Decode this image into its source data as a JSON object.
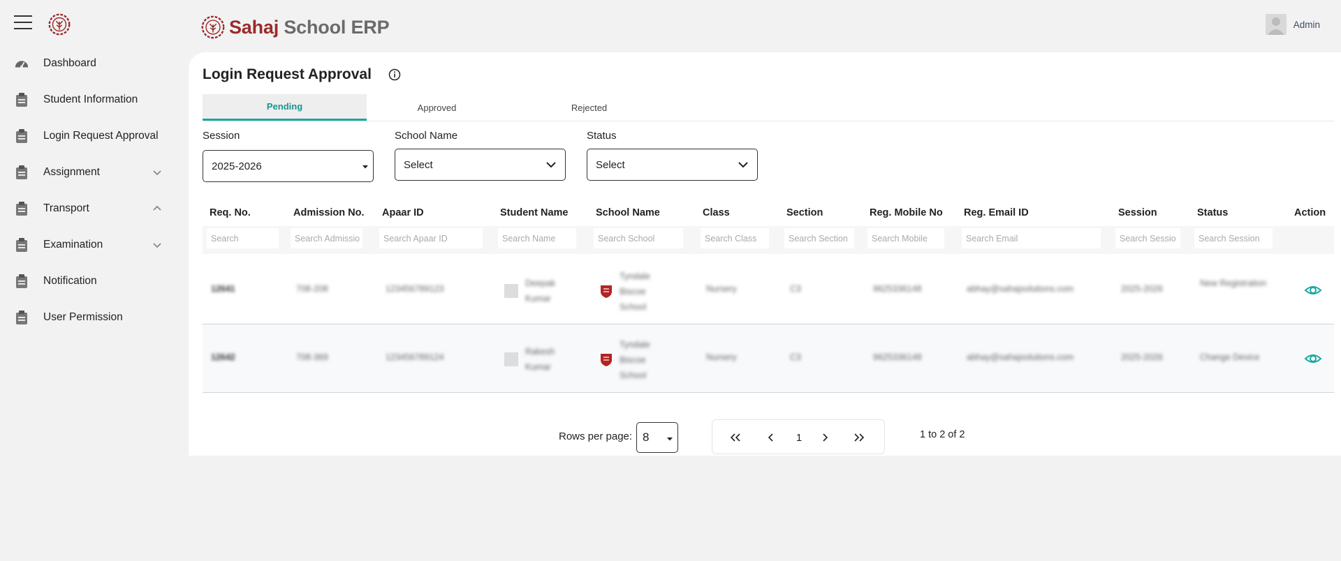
{
  "brand": {
    "name_bold": "Sahaj",
    "name_rest": "School ERP"
  },
  "user": {
    "name": "Admin"
  },
  "sidebar": {
    "items": [
      {
        "label": "Dashboard",
        "icon": "dashboard-gauge-icon"
      },
      {
        "label": "Student Information",
        "icon": "clipboard-icon"
      },
      {
        "label": "Login Request Approval",
        "icon": "clipboard-icon"
      },
      {
        "label": "Assignment",
        "icon": "clipboard-icon",
        "chevron": "down"
      },
      {
        "label": "Transport",
        "icon": "clipboard-icon",
        "chevron": "up"
      },
      {
        "label": "Examination",
        "icon": "clipboard-icon",
        "chevron": "down"
      },
      {
        "label": "Notification",
        "icon": "clipboard-icon"
      },
      {
        "label": "User Permission",
        "icon": "clipboard-icon"
      }
    ]
  },
  "page": {
    "title": "Login Request Approval"
  },
  "tabs": [
    {
      "label": "Pending",
      "active": true
    },
    {
      "label": "Approved",
      "active": false
    },
    {
      "label": "Rejected",
      "active": false
    }
  ],
  "filters": {
    "session": {
      "label": "Session",
      "value": "2025-2026"
    },
    "school": {
      "label": "School Name",
      "value": "Select"
    },
    "status": {
      "label": "Status",
      "value": "Select"
    }
  },
  "table": {
    "columns": [
      {
        "header": "Req. No.",
        "search": "Search"
      },
      {
        "header": "Admission No.",
        "search": "Search Admissio"
      },
      {
        "header": "Apaar ID",
        "search": "Search Apaar ID"
      },
      {
        "header": "Student Name",
        "search": "Search Name"
      },
      {
        "header": "School Name",
        "search": "Search School"
      },
      {
        "header": "Class",
        "search": "Search Class"
      },
      {
        "header": "Section",
        "search": "Search Section"
      },
      {
        "header": "Reg. Mobile No",
        "search": "Search Mobile"
      },
      {
        "header": "Reg. Email ID",
        "search": "Search Email"
      },
      {
        "header": "Session",
        "search": "Search Sessio"
      },
      {
        "header": "Status",
        "search": "Search Session"
      },
      {
        "header": "Action",
        "search": ""
      }
    ],
    "rows": [
      {
        "req_no": "12641",
        "admission_no": "708-208",
        "apaar_id": "123456789123",
        "student_name": "Deepak Kumar",
        "school_name": "Tyndale Biscoe School",
        "class": "Nursery",
        "section": "C3",
        "mobile": "9625336148",
        "email": "abhay@sahajsolutions.com",
        "session": "2025-2026",
        "status": "New Registration"
      },
      {
        "req_no": "12642",
        "admission_no": "708-369",
        "apaar_id": "123456789124",
        "student_name": "Rakesh Kumar",
        "school_name": "Tyndale Biscoe School",
        "class": "Nursery",
        "section": "C3",
        "mobile": "9625336148",
        "email": "abhay@sahajsolutions.com",
        "session": "2025-2026",
        "status": "Change Device"
      }
    ]
  },
  "pagination": {
    "rows_per_page_label": "Rows per page:",
    "rows_per_page": "8",
    "current_page": "1",
    "range_text": "1 to 2 of 2"
  },
  "colors": {
    "brand": "#9b2a2a",
    "accent": "#19a79d",
    "action_icon": "#1aa8a0"
  }
}
